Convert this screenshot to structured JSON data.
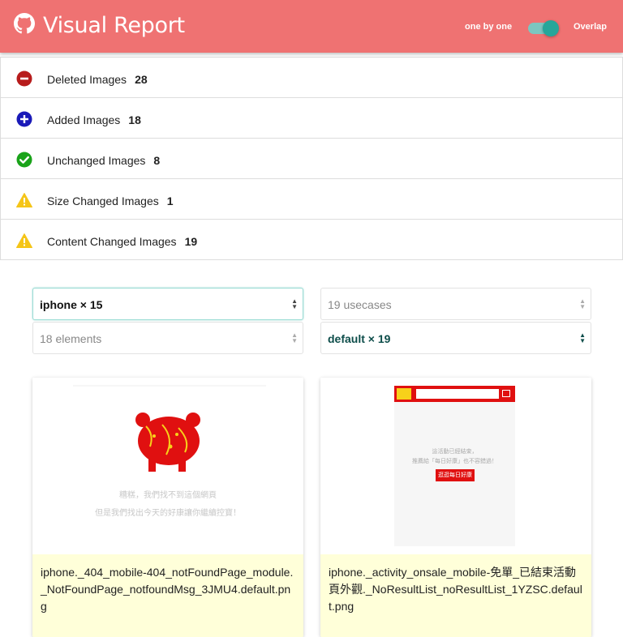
{
  "header": {
    "title": "Visual Report",
    "mode_left": "one by one",
    "mode_right": "Overlap",
    "toggle_on": true,
    "colors": {
      "bar": "#ef7272",
      "toggle": "#26a69a"
    }
  },
  "summary": {
    "rows": [
      {
        "icon": "minus-circle-icon",
        "label": "Deleted Images",
        "count": "28",
        "color": "#b71c1c"
      },
      {
        "icon": "plus-circle-icon",
        "label": "Added Images",
        "count": "18",
        "color": "#1a1ab8"
      },
      {
        "icon": "check-circle-icon",
        "label": "Unchanged Images",
        "count": "8",
        "color": "#1aa31a"
      },
      {
        "icon": "warning-icon",
        "label": "Size Changed Images",
        "count": "1",
        "color": "#f5c518"
      },
      {
        "icon": "warning-icon",
        "label": "Content Changed Images",
        "count": "19",
        "color": "#f5c518"
      }
    ]
  },
  "filters": {
    "device": "iphone × 15",
    "usecases": "19 usecases",
    "elements": "18 elements",
    "variant": "default × 19"
  },
  "cards": [
    {
      "filename": "iphone._404_mobile-404_notFoundPage_module._NotFoundPage_notfoundMsg_3JMU4.default.png",
      "thumb_line1": "糟糕，我們找不到這個網頁",
      "thumb_line2": "但是我們找出今天的好康讓你繼續控寶！"
    },
    {
      "filename": "iphone._activity_onsale_mobile-免單_已結束活動頁外觀._NoResultList_noResultList_1YZSC.default.png",
      "thumb_line1": "這活動已經結束，",
      "thumb_line2": "推薦給「每日好康」也不容錯過！",
      "thumb_button": "逛逛每日好康"
    }
  ]
}
